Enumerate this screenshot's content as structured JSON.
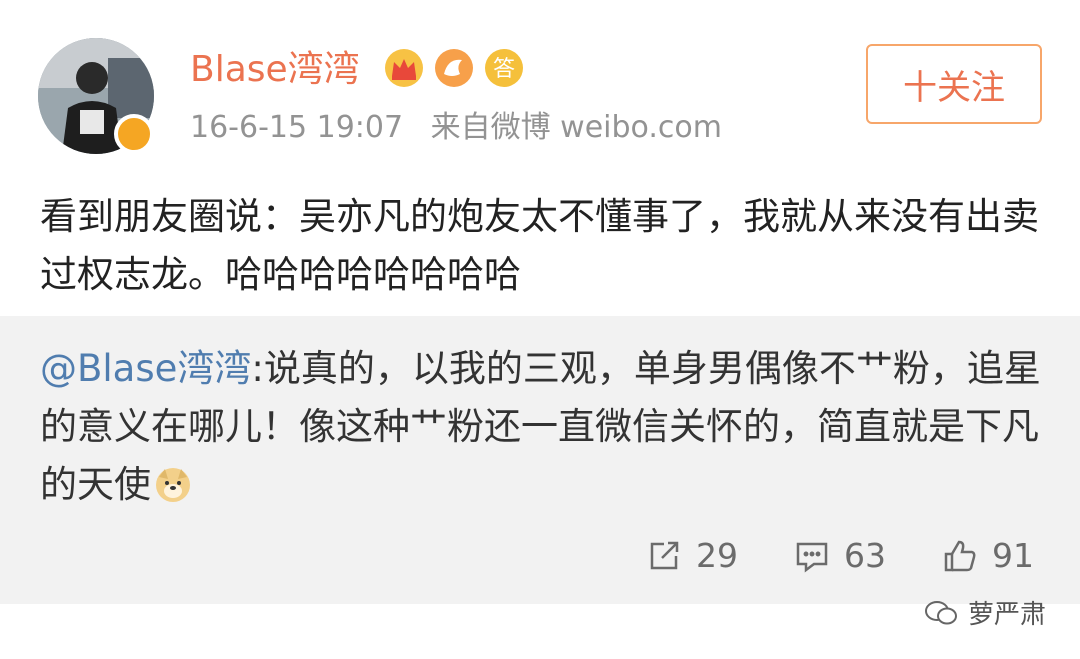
{
  "user": {
    "name": "Blase湾湾",
    "timestamp": "16-6-15 19:07",
    "source": "来自微博 weibo.com",
    "badge_text": "答"
  },
  "follow_button": {
    "label": "十关注"
  },
  "post": {
    "text": "看到朋友圈说：吴亦凡的炮友太不懂事了，我就从来没有出卖过权志龙。哈哈哈哈哈哈哈哈"
  },
  "repost": {
    "mention": "@Blase湾湾",
    "text": ":说真的，以我的三观，单身男偶像不艹粉，追星的意义在哪儿！像这种艹粉还一直微信关怀的，简直就是下凡的天使"
  },
  "actions": {
    "share_count": "29",
    "comment_count": "63",
    "like_count": "91"
  },
  "watermark": {
    "text": "萝严肃"
  },
  "colors": {
    "accent": "#eb7350",
    "link": "#507daf",
    "repost_bg": "#f2f2f2"
  }
}
